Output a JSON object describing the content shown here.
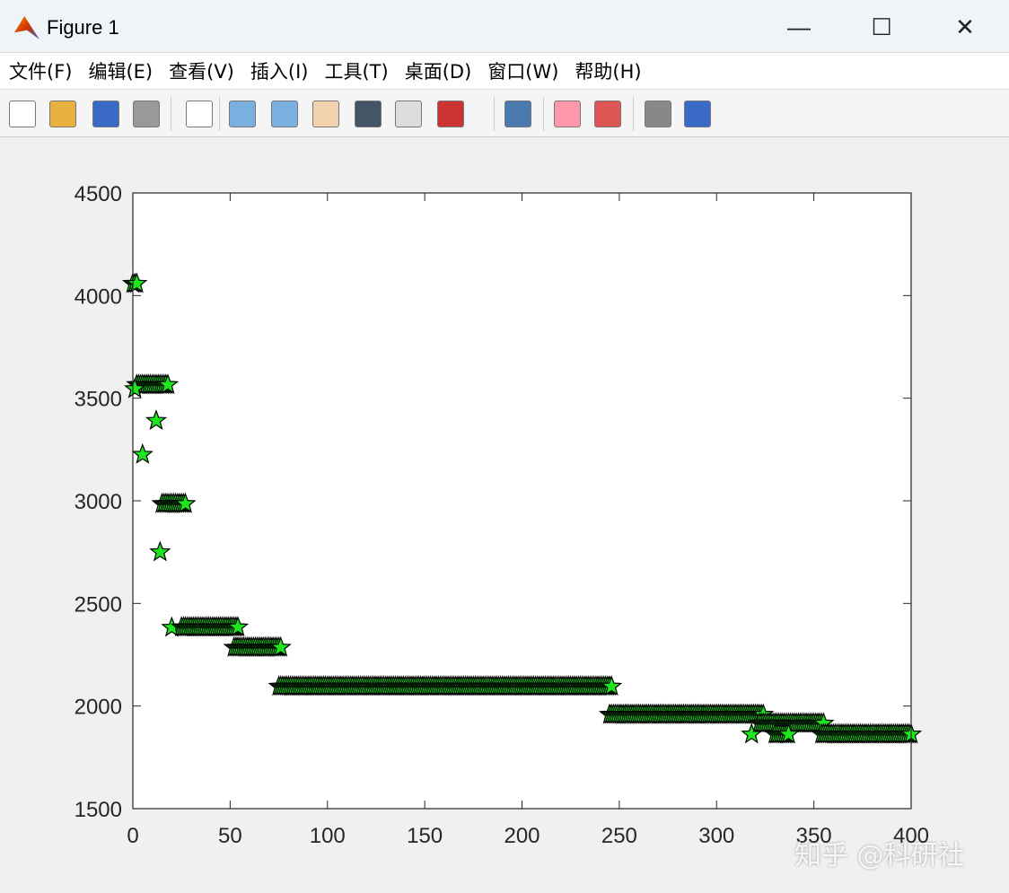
{
  "window": {
    "title": "Figure 1",
    "minimize": "—",
    "maximize": "☐",
    "close": "✕"
  },
  "menu": [
    "文件(F)",
    "编辑(E)",
    "查看(V)",
    "插入(I)",
    "工具(T)",
    "桌面(D)",
    "窗口(W)",
    "帮助(H)"
  ],
  "toolbar": [
    "new-file",
    "open",
    "save",
    "print",
    "select",
    "zoom-in",
    "zoom-out",
    "pan",
    "rotate",
    "data-cursor",
    "brush",
    "link",
    "colorbar",
    "legend",
    "hide-plot-tools",
    "show-plot-tools"
  ],
  "watermark": "知乎 @科研社",
  "chart_data": {
    "type": "scatter",
    "marker": "star",
    "marker_color": "#1ee61e",
    "edge_color": "#000000",
    "xlim": [
      0,
      400
    ],
    "ylim": [
      1500,
      4500
    ],
    "xticks": [
      0,
      50,
      100,
      150,
      200,
      250,
      300,
      350,
      400
    ],
    "yticks": [
      1500,
      2000,
      2500,
      3000,
      3500,
      4000,
      4500
    ],
    "title": "",
    "xlabel": "",
    "ylabel": "",
    "runs": [
      {
        "x_from": 0,
        "x_to": 2,
        "y": 4058
      },
      {
        "x_from": 2,
        "x_to": 18,
        "y": 3565
      },
      {
        "x_from": 1,
        "x_to": 1,
        "y": 3545
      },
      {
        "x_from": 5,
        "x_to": 5,
        "y": 3225
      },
      {
        "x_from": 12,
        "x_to": 12,
        "y": 3390
      },
      {
        "x_from": 14,
        "x_to": 14,
        "y": 2750
      },
      {
        "x_from": 15,
        "x_to": 27,
        "y": 2985
      },
      {
        "x_from": 20,
        "x_to": 20,
        "y": 2382
      },
      {
        "x_from": 25,
        "x_to": 54,
        "y": 2384
      },
      {
        "x_from": 52,
        "x_to": 76,
        "y": 2285
      },
      {
        "x_from": 75,
        "x_to": 246,
        "y": 2095
      },
      {
        "x_from": 245,
        "x_to": 324,
        "y": 1958
      },
      {
        "x_from": 318,
        "x_to": 318,
        "y": 1862
      },
      {
        "x_from": 322,
        "x_to": 355,
        "y": 1915
      },
      {
        "x_from": 330,
        "x_to": 337,
        "y": 1862
      },
      {
        "x_from": 354,
        "x_to": 400,
        "y": 1862
      }
    ]
  }
}
